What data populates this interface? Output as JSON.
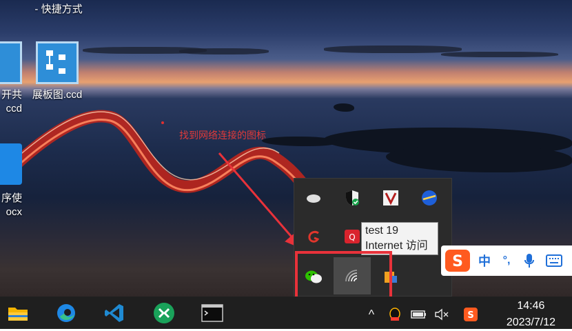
{
  "desktop": {
    "icons": [
      {
        "label_line1": "- 快捷方式",
        "label_line2": ""
      },
      {
        "label_line1": "展板图.ccd",
        "label_line2": ""
      },
      {
        "label_line1": "开共",
        "label_line2": "ccd"
      },
      {
        "label_line1": "序使",
        "label_line2": "ocx"
      }
    ],
    "annotation": "找到网络连接的图标"
  },
  "tray_flyout": {
    "tooltip": {
      "line1": "test 19",
      "line2": "Internet 访问"
    }
  },
  "ime": {
    "mode": "中",
    "punct": "°,"
  },
  "taskbar": {
    "tray_chevron": "^",
    "clock": {
      "time": "14:46",
      "date": "2023/7/12"
    }
  },
  "colors": {
    "highlight": "#e8323a",
    "annotation": "#e03a3a",
    "taskbar": "#1f1f1f"
  }
}
